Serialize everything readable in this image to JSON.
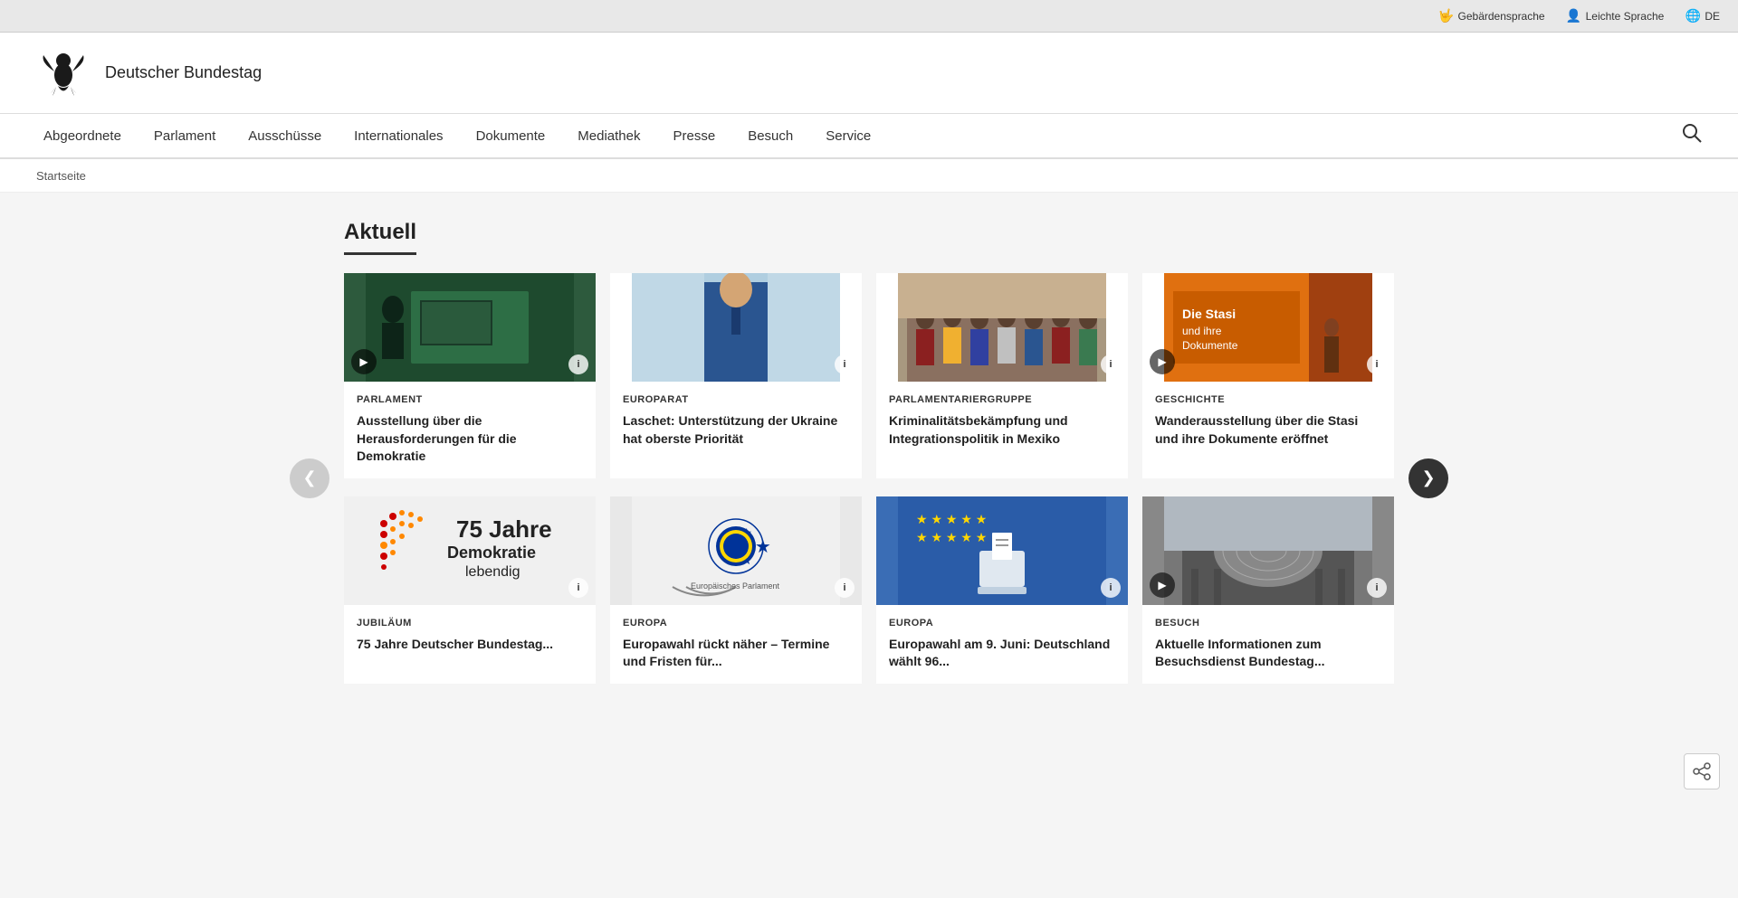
{
  "topbar": {
    "gebaerdensprache": "Gebärdensprache",
    "leichte_sprache": "Leichte Sprache",
    "de": "DE"
  },
  "header": {
    "site_title": "Deutscher Bundestag"
  },
  "nav": {
    "items": [
      {
        "label": "Abgeordnete",
        "id": "abgeordnete"
      },
      {
        "label": "Parlament",
        "id": "parlament"
      },
      {
        "label": "Ausschüsse",
        "id": "ausschuesse"
      },
      {
        "label": "Internationales",
        "id": "internationales"
      },
      {
        "label": "Dokumente",
        "id": "dokumente"
      },
      {
        "label": "Mediathek",
        "id": "mediathek"
      },
      {
        "label": "Presse",
        "id": "presse"
      },
      {
        "label": "Besuch",
        "id": "besuch"
      },
      {
        "label": "Service",
        "id": "service"
      }
    ]
  },
  "breadcrumb": {
    "label": "Startseite"
  },
  "section": {
    "title": "Aktuell"
  },
  "cards_row1": [
    {
      "id": "card1",
      "category": "Parlament",
      "title": "Ausstellung über die Herausforderungen für die Demokratie",
      "has_play": true,
      "has_info": true,
      "img_type": "dark_green"
    },
    {
      "id": "card2",
      "category": "Europarat",
      "title": "Laschet: Unterstützung der Ukraine hat oberste Priorität",
      "has_play": false,
      "has_info": true,
      "img_type": "blue_suit"
    },
    {
      "id": "card3",
      "category": "Parlamentariergruppe",
      "title": "Kriminalitätsbekämpfung und Integrationspolitik in Mexiko",
      "has_play": false,
      "has_info": true,
      "img_type": "group"
    },
    {
      "id": "card4",
      "category": "Geschichte",
      "title": "Wanderausstellung über die Stasi und ihre Dokumente eröffnet",
      "has_play": true,
      "has_info": true,
      "img_type": "stasi"
    }
  ],
  "cards_row2": [
    {
      "id": "card5",
      "category": "Jubiläum",
      "title": "75 Jahre Deutscher Bundestag...",
      "has_play": false,
      "has_info": true,
      "img_type": "demokratie"
    },
    {
      "id": "card6",
      "category": "Europa",
      "title": "Europawahl rückt näher – Termine und Fristen für...",
      "has_play": false,
      "has_info": true,
      "img_type": "eu_parliament"
    },
    {
      "id": "card7",
      "category": "Europa",
      "title": "Europawahl am 9. Juni: Deutschland wählt 96...",
      "has_play": false,
      "has_info": true,
      "img_type": "eu_vote"
    },
    {
      "id": "card8",
      "category": "Besuch",
      "title": "Aktuelle Informationen zum Besuchsdienst Bundestag...",
      "has_play": true,
      "has_info": true,
      "img_type": "reichstag"
    }
  ],
  "carousel": {
    "prev_label": "‹",
    "next_label": "›"
  },
  "share_icon": "share"
}
